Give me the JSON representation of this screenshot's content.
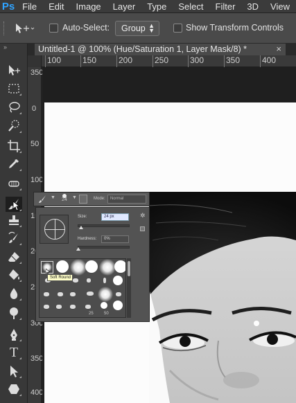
{
  "app": {
    "logo": "Ps"
  },
  "menubar": [
    "File",
    "Edit",
    "Image",
    "Layer",
    "Type",
    "Select",
    "Filter",
    "3D",
    "View"
  ],
  "options": {
    "move_tool_icon": "move-tool-icon",
    "auto_select_label": "Auto-Select:",
    "auto_select_checked": false,
    "auto_select_target": "Group",
    "show_transform_label": "Show Transform Controls",
    "show_transform_checked": false
  },
  "document_tab": {
    "title": "Untitled-1 @ 100% (Hue/Saturation 1, Layer Mask/8) *",
    "close": "×"
  },
  "ruler": {
    "horizontal": [
      "100",
      "150",
      "200",
      "250",
      "300",
      "350",
      "400"
    ],
    "vertical": [
      "350",
      "0",
      "50",
      "100",
      "150",
      "200",
      "250",
      "300",
      "350",
      "400"
    ]
  },
  "toolbox": {
    "collapse": "»",
    "tools": [
      "move-tool",
      "marquee-tool",
      "lasso-tool",
      "quick-selection-tool",
      "crop-tool",
      "eyedropper-tool",
      "spot-healing-tool",
      "brush-tool",
      "clone-stamp-tool",
      "history-brush-tool",
      "eraser-tool",
      "paint-bucket-tool",
      "blur-tool",
      "dodge-tool",
      "pen-tool",
      "type-tool",
      "path-selection-tool",
      "shape-tool"
    ],
    "active": "brush-tool",
    "type_glyph": "T"
  },
  "brush_options": {
    "size_preview": "24",
    "mode_label": "Mode:",
    "mode_value": "Normal"
  },
  "brush_picker": {
    "size_label": "Size:",
    "size_value": "24 px",
    "hardness_label": "Hardness:",
    "hardness_value": "0%",
    "size_fraction": 0.05,
    "hardness_fraction": 0.0,
    "preset_labels": [
      "25",
      "50"
    ],
    "tooltip": "Soft Round"
  }
}
